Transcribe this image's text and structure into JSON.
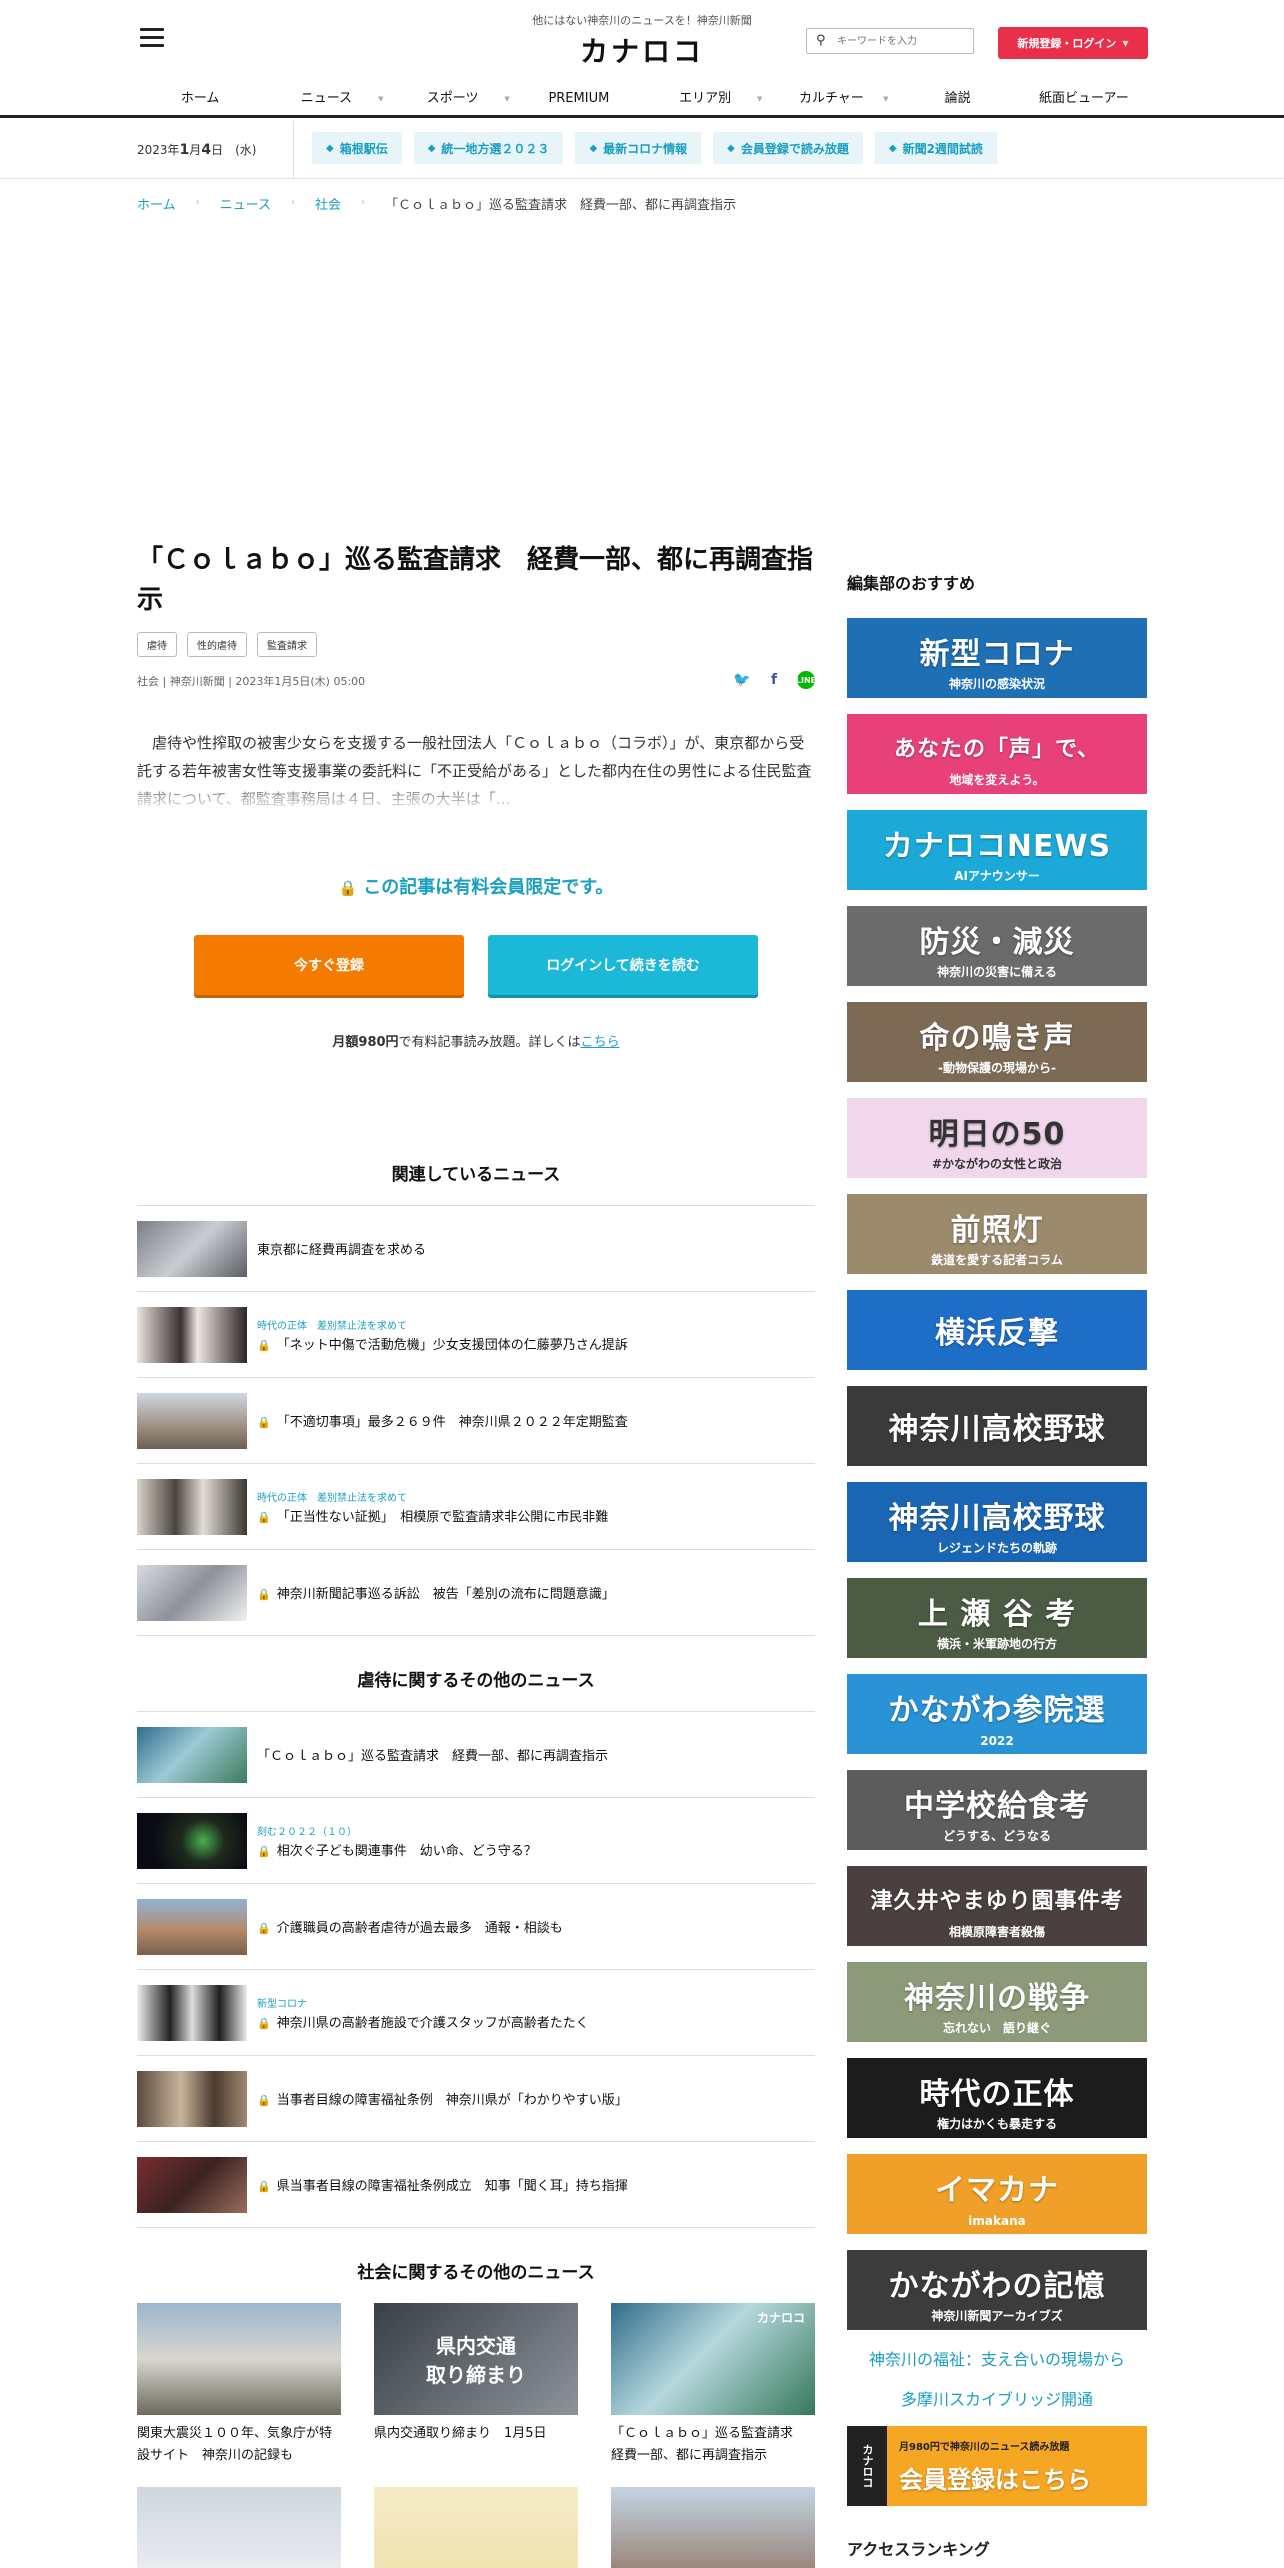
{
  "header": {
    "tagline": "他にはない神奈川のニュースを！神奈川新聞",
    "logo": "カナロコ",
    "search_placeholder": "キーワードを入力",
    "signup_label": "新規登録・ログイン",
    "nav": [
      "ホーム",
      "ニュース",
      "スポーツ",
      "PREMIUM",
      "エリア別",
      "カルチャー",
      "論説",
      "紙面ビューアー"
    ]
  },
  "subbar": {
    "date_prefix": "2023年",
    "date_month": "1",
    "date_mid": "月",
    "date_day": "4",
    "date_suffix": "日　(水)",
    "tags": [
      "箱根駅伝",
      "統一地方選２０２３",
      "最新コロナ情報",
      "会員登録で読み放題",
      "新聞2週間試読"
    ]
  },
  "breadcrumb": [
    "ホーム",
    "ニュース",
    "社会",
    "「Ｃｏｌａｂｏ」巡る監査請求　経費一部、都に再調査指示"
  ],
  "article": {
    "title": "「Ｃｏｌａｂｏ」巡る監査請求　経費一部、都に再調査指示",
    "keywords": [
      "虐待",
      "性的虐待",
      "監査請求"
    ],
    "meta": "社会 | 神奈川新聞 | 2023年1月5日(木) 05:00",
    "lead": "　虐待や性搾取の被害少女らを支援する一般社団法人「Ｃｏｌａｂｏ（コラボ）」が、東京都から受託する若年被害女性等支援事業の委託料に「不正受給がある」とした都内在住の男性による住民監査請求について、都監査事務局は４日、主張の大半は「…",
    "paywall": "この記事は有料会員限定です。",
    "btn_register": "今すぐ登録",
    "btn_login": "ログインして続きを読む",
    "price_bold": "月額980円",
    "price_text": "で有料記事読み放題。詳しくは",
    "price_link": "こちら"
  },
  "related": {
    "title": "関連しているニュース",
    "items": [
      {
        "kicker": "",
        "locked": false,
        "title": "東京都に経費再調査を求める"
      },
      {
        "kicker": "時代の正体　差別禁止法を求めて",
        "locked": true,
        "title": "「ネット中傷で活動危機」少女支援団体の仁藤夢乃さん提訴"
      },
      {
        "kicker": "",
        "locked": true,
        "title": "「不適切事項」最多２６９件　神奈川県２０２２年定期監査"
      },
      {
        "kicker": "時代の正体　差別禁止法を求めて",
        "locked": true,
        "title": "「正当性ない証拠」　相模原で監査請求非公開に市民非難"
      },
      {
        "kicker": "",
        "locked": true,
        "title": "神奈川新聞記事巡る訴訟　被告「差別の流布に問題意識」"
      }
    ]
  },
  "abuse": {
    "title": "虐待に関するその他のニュース",
    "items": [
      {
        "kicker": "",
        "locked": false,
        "title": "「Ｃｏｌａｂｏ」巡る監査請求　経費一部、都に再調査指示"
      },
      {
        "kicker": "刻む２０２２（１０）",
        "locked": true,
        "title": "相次ぐ子ども関連事件　幼い命、どう守る？"
      },
      {
        "kicker": "",
        "locked": true,
        "title": "介護職員の高齢者虐待が過去最多　通報・相談も"
      },
      {
        "kicker": "新型コロナ",
        "locked": true,
        "title": "神奈川県の高齢者施設で介護スタッフが高齢者たたく"
      },
      {
        "kicker": "",
        "locked": true,
        "title": "当事者目線の障害福祉条例　神奈川県が「わかりやすい版」"
      },
      {
        "kicker": "",
        "locked": true,
        "title": "県当事者目線の障害福祉条例成立　知事「聞く耳」持ち指揮"
      }
    ]
  },
  "society": {
    "title": "社会に関するその他のニュース",
    "items": [
      {
        "title": "関東大震災１００年、気象庁が特設サイト　神奈川の記録も"
      },
      {
        "title": "県内交通取り締まり　1月5日",
        "image_text": "県内交通\n取り締まり"
      },
      {
        "title": "「Ｃｏｌａｂｏ」巡る監査請求　経費一部、都に再調査指示",
        "image_text": "カナロコ"
      }
    ]
  },
  "sidebar": {
    "heading": "編集部のおすすめ",
    "banners": [
      {
        "text": "新型コロナ",
        "sub": "神奈川の感染状況",
        "color": "#1f6fb5"
      },
      {
        "text": "あなたの「声」で、",
        "sub": "地域を変えよう。",
        "color": "#e8417a"
      },
      {
        "text": "カナロコNEWS",
        "sub": "AIアナウンサー",
        "color": "#1ca9d8"
      },
      {
        "text": "防災・減災",
        "sub": "神奈川の災害に備える",
        "color": "#6b6b6b"
      },
      {
        "text": "命の鳴き声",
        "sub": "-動物保護の現場から-",
        "color": "#7c6a55"
      },
      {
        "text": "明日の50",
        "sub": "#かながわの女性と政治",
        "color": "#f1d7ec"
      },
      {
        "text": "前照灯",
        "sub": "鉄道を愛する記者コラム",
        "color": "#9b8a6c"
      },
      {
        "text": "横浜反撃",
        "sub": "",
        "color": "#1e6ec8"
      },
      {
        "text": "神奈川高校野球",
        "sub": "",
        "color": "#3a3a3a"
      },
      {
        "text": "神奈川高校野球",
        "sub": "レジェンドたちの軌跡",
        "color": "#1a66b4"
      },
      {
        "text": "上 瀬 谷 考",
        "sub": "横浜・米軍跡地の行方",
        "color": "#4b5b44"
      },
      {
        "text": "かながわ参院選",
        "sub": "2022",
        "color": "#2a93d5"
      },
      {
        "text": "中学校給食考",
        "sub": "どうする、どうなる",
        "color": "#5c5c5c"
      },
      {
        "text": "津久井やまゆり園事件考",
        "sub": "相模原障害者殺傷",
        "color": "#4a4040"
      },
      {
        "text": "神奈川の戦争",
        "sub": "忘れない　語り継ぐ",
        "color": "#8c9a7a"
      },
      {
        "text": "時代の正体",
        "sub": "権力はかくも暴走する",
        "color": "#1c1c1c"
      },
      {
        "text": "イマカナ",
        "sub": "imakana",
        "color": "#f0a028"
      },
      {
        "text": "かながわの記憶",
        "sub": "神奈川新聞アーカイブズ",
        "color": "#3c3c3c"
      }
    ],
    "links": [
      "神奈川の福祉：支え合いの現場から",
      "多摩川スカイブリッジ開通"
    ],
    "member_banner": {
      "main": "会員登録はこちら",
      "sub": "月980円で神奈川のニュース読み放題",
      "logo": "カナロコ",
      "color": "#f5a623"
    },
    "ranking_title": "アクセスランキング"
  }
}
